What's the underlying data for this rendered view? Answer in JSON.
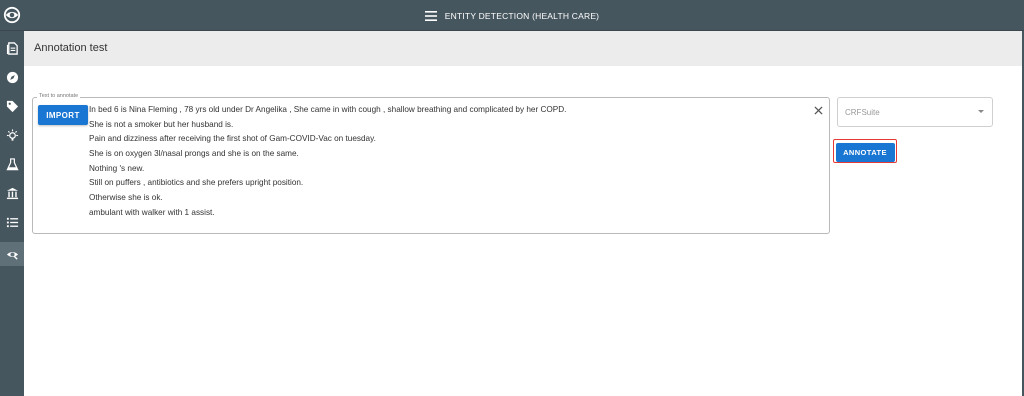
{
  "header": {
    "app_title": "ENTITY DETECTION (HEALTH CARE)",
    "logo_icon": "eye-logo-icon",
    "menu_icon": "hamburger-menu-icon"
  },
  "sidebar": {
    "items": [
      {
        "icon": "document-icon",
        "active": false
      },
      {
        "icon": "compass-icon",
        "active": false
      },
      {
        "icon": "tag-icon",
        "active": false
      },
      {
        "icon": "lightbulb-icon",
        "active": false
      },
      {
        "icon": "flask-icon",
        "active": false
      },
      {
        "icon": "bank-icon",
        "active": false
      },
      {
        "icon": "list-icon",
        "active": false
      },
      {
        "icon": "eye-icon",
        "active": true
      }
    ]
  },
  "page": {
    "title": "Annotation test"
  },
  "text_field": {
    "legend": "Text to annotate",
    "import_label": "IMPORT",
    "lines": [
      "In bed 6 is Nina Fleming , 78 yrs old under Dr Angelika , She came in with cough , shallow breathing and complicated by her COPD.",
      "She is not a smoker but her husband is.",
      "Pain and dizziness after receiving the first shot of Gam-COVID-Vac on tuesday.",
      "She is on oxygen 3l/nasal prongs and she is on the same.",
      "Nothing 's new.",
      "Still on puffers , antibiotics and she prefers upright position.",
      "Otherwise she is ok.",
      "ambulant with walker with 1 assist."
    ]
  },
  "model_select": {
    "value": "CRFSuite"
  },
  "annotate_button": {
    "label": "ANNOTATE"
  },
  "colors": {
    "sidebar": "#46565f",
    "primary": "#1976d2",
    "highlight": "#e53935",
    "page_header": "#ececec"
  }
}
